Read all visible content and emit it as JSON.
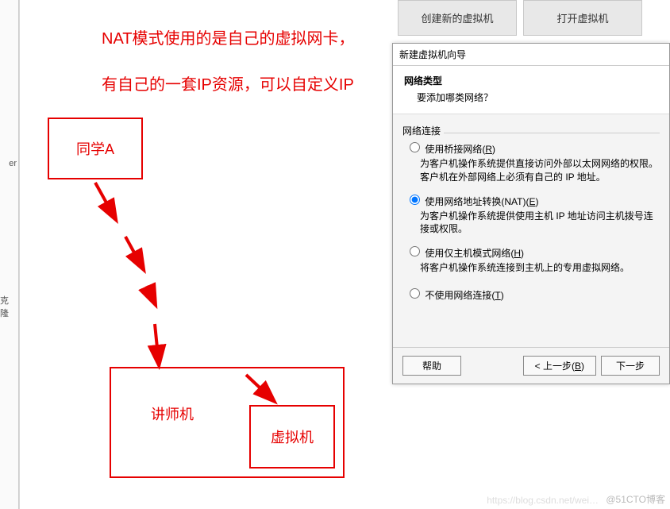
{
  "left_sidebar": {
    "label_er": "er",
    "label_clone": "克隆"
  },
  "annotation": {
    "line1": "NAT模式使用的是自己的虚拟网卡，",
    "line2": "有自己的一套IP资源，可以自定义IP"
  },
  "diagram": {
    "box_student": "同学A",
    "box_teacher": "讲师机",
    "box_vm": "虚拟机"
  },
  "top_buttons": {
    "create_vm": "创建新的虚拟机",
    "open_vm": "打开虚拟机"
  },
  "wizard": {
    "window_title": "新建虚拟机向导",
    "heading": "网络类型",
    "subheading": "要添加哪类网络？",
    "group_label": "网络连接",
    "options": {
      "bridge": {
        "label_pre": "使用桥接网络(",
        "label_key": "R",
        "label_post": ")",
        "desc": "为客户机操作系统提供直接访问外部以太网网络的权限。客户机在外部网络上必须有自己的 IP 地址。"
      },
      "nat": {
        "label_pre": "使用网络地址转换(NAT)(",
        "label_key": "E",
        "label_post": ")",
        "desc": "为客户机操作系统提供使用主机 IP 地址访问主机拨号连接或权限。"
      },
      "hostonly": {
        "label_pre": "使用仅主机模式网络(",
        "label_key": "H",
        "label_post": ")",
        "desc": "将客户机操作系统连接到主机上的专用虚拟网络。"
      },
      "none": {
        "label_pre": "不使用网络连接(",
        "label_key": "T",
        "label_post": ")"
      }
    },
    "footer": {
      "help": "帮助",
      "back_pre": "< 上一步(",
      "back_key": "B",
      "back_post": ")",
      "next": "下一步"
    }
  },
  "watermark": {
    "left": "https://blog.csdn.net/wei…",
    "right": "@51CTO博客"
  }
}
